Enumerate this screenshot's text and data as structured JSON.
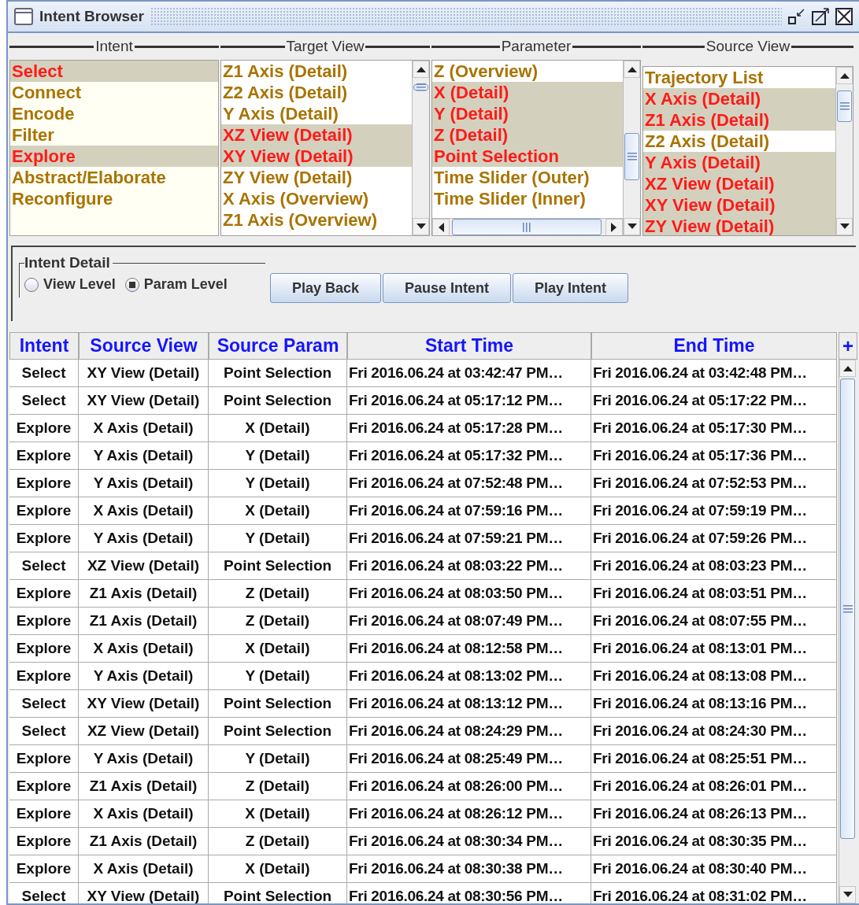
{
  "window": {
    "title": "Intent Browser"
  },
  "lists": [
    {
      "heading": "Intent",
      "items": [
        {
          "label": "Select",
          "selected": true
        },
        {
          "label": "Connect",
          "selected": false
        },
        {
          "label": "Encode",
          "selected": false
        },
        {
          "label": "Filter",
          "selected": false
        },
        {
          "label": "Explore",
          "selected": true
        },
        {
          "label": "Abstract/Elaborate",
          "selected": false
        },
        {
          "label": "Reconfigure",
          "selected": false
        }
      ]
    },
    {
      "heading": "Target View",
      "items": [
        {
          "label": "Z1 Axis (Detail)",
          "selected": false
        },
        {
          "label": "Z2 Axis (Detail)",
          "selected": false
        },
        {
          "label": "Y Axis (Detail)",
          "selected": false
        },
        {
          "label": "XZ View (Detail)",
          "selected": true
        },
        {
          "label": "XY View (Detail)",
          "selected": true
        },
        {
          "label": "ZY View (Detail)",
          "selected": false
        },
        {
          "label": "X Axis (Overview)",
          "selected": false
        },
        {
          "label": "Z1 Axis (Overview)",
          "selected": false
        }
      ]
    },
    {
      "heading": "Parameter",
      "items": [
        {
          "label": "Z (Overview)",
          "selected": false
        },
        {
          "label": "X (Detail)",
          "selected": true
        },
        {
          "label": "Y (Detail)",
          "selected": true
        },
        {
          "label": "Z (Detail)",
          "selected": true
        },
        {
          "label": "Point Selection",
          "selected": true
        },
        {
          "label": "Time Slider (Outer)",
          "selected": false
        },
        {
          "label": "Time Slider (Inner)",
          "selected": false
        }
      ]
    },
    {
      "heading": "Source View",
      "items": [
        {
          "label": "Trajectory List",
          "selected": false
        },
        {
          "label": "X Axis (Detail)",
          "selected": true
        },
        {
          "label": "Z1 Axis (Detail)",
          "selected": true
        },
        {
          "label": "Z2 Axis (Detail)",
          "selected": false
        },
        {
          "label": "Y Axis (Detail)",
          "selected": true
        },
        {
          "label": "XZ View (Detail)",
          "selected": true
        },
        {
          "label": "XY View (Detail)",
          "selected": true
        },
        {
          "label": "ZY View (Detail)",
          "selected": true
        }
      ]
    }
  ],
  "intent_detail": {
    "title": "Intent Detail",
    "options": [
      {
        "label": "View Level",
        "selected": false
      },
      {
        "label": "Param Level",
        "selected": true
      }
    ]
  },
  "buttons": [
    "Play Back",
    "Pause Intent",
    "Play Intent"
  ],
  "table": {
    "columns": [
      "Intent",
      "Source View",
      "Source Param",
      "Start Time",
      "End Time"
    ],
    "add_button": "+",
    "rows": [
      [
        "Select",
        "XY View (Detail)",
        "Point Selection",
        "Fri 2016.06.24 at 03:42:47 PM…",
        "Fri 2016.06.24 at 03:42:48 PM…"
      ],
      [
        "Select",
        "XY View (Detail)",
        "Point Selection",
        "Fri 2016.06.24 at 05:17:12 PM…",
        "Fri 2016.06.24 at 05:17:22 PM…"
      ],
      [
        "Explore",
        "X Axis (Detail)",
        "X (Detail)",
        "Fri 2016.06.24 at 05:17:28 PM…",
        "Fri 2016.06.24 at 05:17:30 PM…"
      ],
      [
        "Explore",
        "Y Axis (Detail)",
        "Y (Detail)",
        "Fri 2016.06.24 at 05:17:32 PM…",
        "Fri 2016.06.24 at 05:17:36 PM…"
      ],
      [
        "Explore",
        "Y Axis (Detail)",
        "Y (Detail)",
        "Fri 2016.06.24 at 07:52:48 PM…",
        "Fri 2016.06.24 at 07:52:53 PM…"
      ],
      [
        "Explore",
        "X Axis (Detail)",
        "X (Detail)",
        "Fri 2016.06.24 at 07:59:16 PM…",
        "Fri 2016.06.24 at 07:59:19 PM…"
      ],
      [
        "Explore",
        "Y Axis (Detail)",
        "Y (Detail)",
        "Fri 2016.06.24 at 07:59:21 PM…",
        "Fri 2016.06.24 at 07:59:26 PM…"
      ],
      [
        "Select",
        "XZ View (Detail)",
        "Point Selection",
        "Fri 2016.06.24 at 08:03:22 PM…",
        "Fri 2016.06.24 at 08:03:23 PM…"
      ],
      [
        "Explore",
        "Z1 Axis (Detail)",
        "Z (Detail)",
        "Fri 2016.06.24 at 08:03:50 PM…",
        "Fri 2016.06.24 at 08:03:51 PM…"
      ],
      [
        "Explore",
        "Z1 Axis (Detail)",
        "Z (Detail)",
        "Fri 2016.06.24 at 08:07:49 PM…",
        "Fri 2016.06.24 at 08:07:55 PM…"
      ],
      [
        "Explore",
        "X Axis (Detail)",
        "X (Detail)",
        "Fri 2016.06.24 at 08:12:58 PM…",
        "Fri 2016.06.24 at 08:13:01 PM…"
      ],
      [
        "Explore",
        "Y Axis (Detail)",
        "Y (Detail)",
        "Fri 2016.06.24 at 08:13:02 PM…",
        "Fri 2016.06.24 at 08:13:08 PM…"
      ],
      [
        "Select",
        "XY View (Detail)",
        "Point Selection",
        "Fri 2016.06.24 at 08:13:12 PM…",
        "Fri 2016.06.24 at 08:13:16 PM…"
      ],
      [
        "Select",
        "XZ View (Detail)",
        "Point Selection",
        "Fri 2016.06.24 at 08:24:29 PM…",
        "Fri 2016.06.24 at 08:24:30 PM…"
      ],
      [
        "Explore",
        "Y Axis (Detail)",
        "Y (Detail)",
        "Fri 2016.06.24 at 08:25:49 PM…",
        "Fri 2016.06.24 at 08:25:51 PM…"
      ],
      [
        "Explore",
        "Z1 Axis (Detail)",
        "Z (Detail)",
        "Fri 2016.06.24 at 08:26:00 PM…",
        "Fri 2016.06.24 at 08:26:01 PM…"
      ],
      [
        "Explore",
        "X Axis (Detail)",
        "X (Detail)",
        "Fri 2016.06.24 at 08:26:12 PM…",
        "Fri 2016.06.24 at 08:26:13 PM…"
      ],
      [
        "Explore",
        "Z1 Axis (Detail)",
        "Z (Detail)",
        "Fri 2016.06.24 at 08:30:34 PM…",
        "Fri 2016.06.24 at 08:30:35 PM…"
      ],
      [
        "Explore",
        "X Axis (Detail)",
        "X (Detail)",
        "Fri 2016.06.24 at 08:30:38 PM…",
        "Fri 2016.06.24 at 08:30:40 PM…"
      ],
      [
        "Select",
        "XY View (Detail)",
        "Point Selection",
        "Fri 2016.06.24 at 08:30:56 PM…",
        "Fri 2016.06.24 at 08:31:02 PM…"
      ]
    ]
  }
}
